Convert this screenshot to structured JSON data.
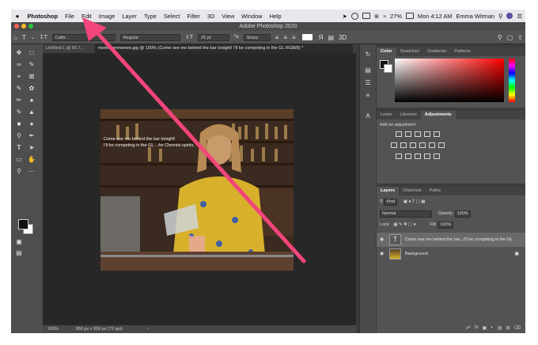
{
  "menubar": {
    "apple": "",
    "items": [
      "Photoshop",
      "File",
      "Edit",
      "Image",
      "Layer",
      "Type",
      "Select",
      "Filter",
      "3D",
      "View",
      "Window",
      "Help"
    ],
    "battery": "27%",
    "clock": "Mon 4:12 AM",
    "user": "Emma Witman"
  },
  "titlebar": {
    "title": "Adobe Photoshop 2020"
  },
  "options": {
    "tool_glyph": "T",
    "font_family": "Calib...",
    "font_style": "Regular",
    "font_size": "25 pt",
    "aa_label": "ªa",
    "antialias": "Sharp"
  },
  "tabs": [
    {
      "label": "Untitled-1 @ 66.7..."
    },
    {
      "label": "memmemmeeee.jpg @ 100% (Come see me behind the bar tonight! I'll be competing in the GL RGB/8) *"
    }
  ],
  "canvas": {
    "overlay_line1": "Come see me behind the bar tonight!",
    "overlay_line2": "I'll be competing in the GL ...for Chemist spirits."
  },
  "status": {
    "zoom": "100%",
    "doc_size": "958 px x 958 px (72 ppi)"
  },
  "color_panel": {
    "tabs": [
      "Color",
      "Swatches",
      "Gradients",
      "Patterns"
    ],
    "accent": "#ff0000"
  },
  "adjust_panel": {
    "tabs": [
      "Learn",
      "Libraries",
      "Adjustments"
    ],
    "add_label": "Add an adjustment"
  },
  "layers_panel": {
    "tabs": [
      "Layers",
      "Channels",
      "Paths"
    ],
    "kind": "Kind",
    "blend": "Normal",
    "opacity_label": "Opacity:",
    "opacity": "100%",
    "lock_label": "Lock:",
    "fill_label": "Fill:",
    "fill": "100%",
    "layers": [
      {
        "name": "Come see me behind the bar...I'll be competing in the GL",
        "type": "text"
      },
      {
        "name": "Background",
        "type": "image"
      }
    ]
  },
  "annotation_color": "#f2457a"
}
